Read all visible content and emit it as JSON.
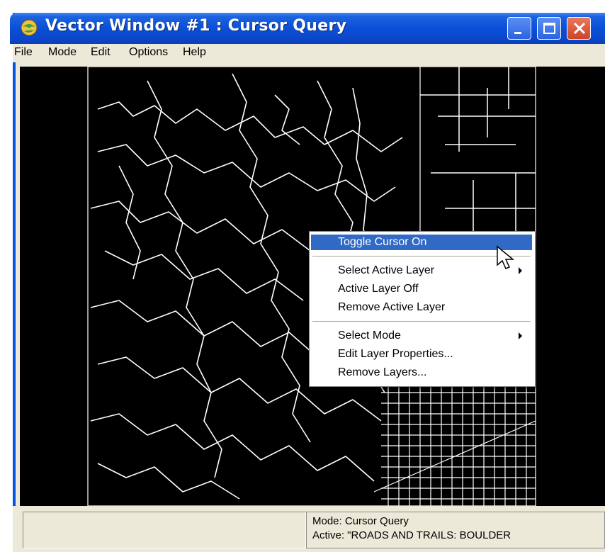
{
  "window": {
    "title": "Vector Window #1 : Cursor Query",
    "app_icon": "globe-icon",
    "buttons": [
      "minimize-icon",
      "maximize-icon",
      "close-icon"
    ]
  },
  "menubar": {
    "items": [
      "File",
      "Mode",
      "Edit",
      "Options",
      "Help"
    ]
  },
  "context_menu": {
    "items": [
      {
        "label": "Toggle Cursor On",
        "highlighted": true
      },
      {
        "label": "Select Active Layer",
        "submenu": true
      },
      {
        "label": "Active Layer Off"
      },
      {
        "label": "Remove Active Layer"
      },
      {
        "label": "Select Mode",
        "submenu": true
      },
      {
        "label": "Edit Layer Properties..."
      },
      {
        "label": "Remove Layers..."
      }
    ]
  },
  "status": {
    "mode": "Mode: Cursor Query",
    "active": "Active: \"ROADS AND TRAILS: BOULDER"
  },
  "colors": {
    "titlebar": "#0a4fd8",
    "highlight": "#316ac5",
    "map_background": "#000000",
    "map_lines": "#ffffff"
  }
}
